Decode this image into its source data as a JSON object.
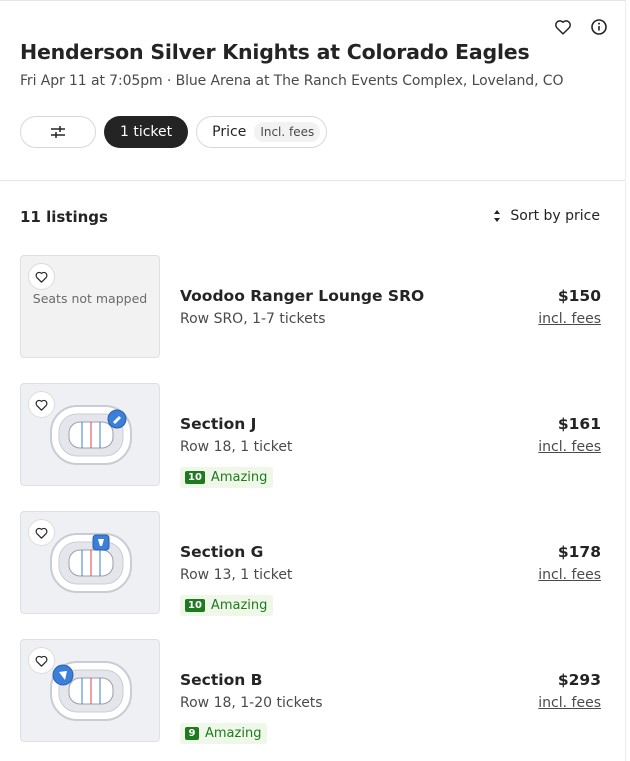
{
  "event": {
    "title": "Henderson Silver Knights at Colorado Eagles",
    "subtitle": "Fri Apr 11 at 7:05pm · Blue Arena at The Ranch Events Complex, Loveland, CO"
  },
  "top_icons": [
    "heart-icon",
    "info-icon"
  ],
  "filters": {
    "quantity_label": "1 ticket",
    "price_label": "Price",
    "price_fees_tag": "Incl. fees"
  },
  "listings_header": {
    "count": "11 listings",
    "sort_label": "Sort by price"
  },
  "listings": [
    {
      "name": "Voodoo Ranger Lounge SRO",
      "row": "Row SRO, 1-7 tickets",
      "price": "$150",
      "price_note": "incl. fees",
      "map_text": "Seats not mapped",
      "deal": null
    },
    {
      "name": "Section J",
      "row": "Row 18, 1 ticket",
      "price": "$161",
      "price_note": "incl. fees",
      "deal": {
        "score": "10",
        "label": "Amazing"
      }
    },
    {
      "name": "Section G",
      "row": "Row 13, 1 ticket",
      "price": "$178",
      "price_note": "incl. fees",
      "deal": {
        "score": "10",
        "label": "Amazing"
      }
    },
    {
      "name": "Section B",
      "row": "Row 18, 1-20 tickets",
      "price": "$293",
      "price_note": "incl. fees",
      "deal": {
        "score": "9",
        "label": "Amazing"
      }
    }
  ],
  "colors": {
    "text": "#242424",
    "secondary_text": "#4a4a4a",
    "deal_green": "#1f7a1f",
    "deal_bg": "#eef7e8",
    "section_highlight": "#3b7fd9"
  }
}
